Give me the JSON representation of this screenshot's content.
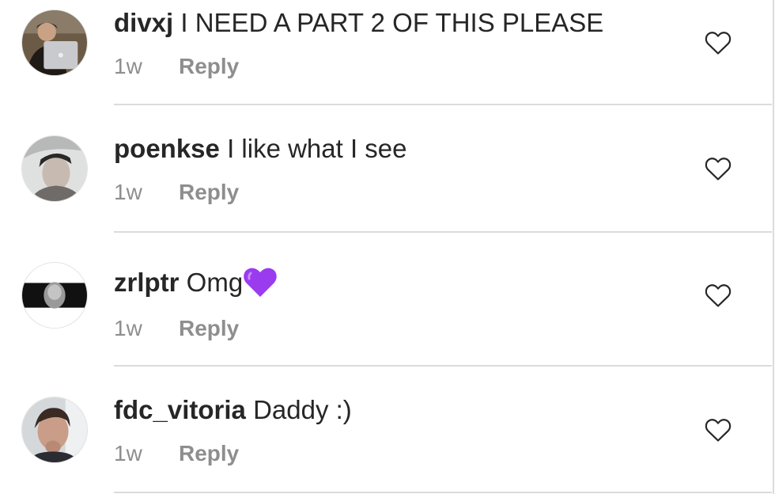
{
  "comments": [
    {
      "username": "divxj",
      "text": "I NEED A PART 2 OF THIS PLEASE",
      "time": "1w",
      "reply_label": "Reply",
      "avatar_icon": "user-avatar-laptop-icon",
      "like_icon": "heart-outline-icon"
    },
    {
      "username": "poenkse",
      "text": "I like what I see",
      "time": "1w",
      "reply_label": "Reply",
      "avatar_icon": "user-avatar-icon",
      "like_icon": "heart-outline-icon"
    },
    {
      "username": "zrlptr",
      "text": "Omg",
      "emoji": "💜",
      "time": "1w",
      "reply_label": "Reply",
      "avatar_icon": "user-avatar-icon",
      "like_icon": "heart-outline-icon"
    },
    {
      "username": "fdc_vitoria",
      "text": "Daddy :)",
      "time": "1w",
      "reply_label": "Reply",
      "avatar_icon": "user-avatar-icon",
      "like_icon": "heart-outline-icon"
    }
  ],
  "colors": {
    "text_primary": "#262626",
    "text_secondary": "#8e8e8e",
    "divider": "#dbdbdb",
    "emoji_purple": "#9b3bf0"
  }
}
